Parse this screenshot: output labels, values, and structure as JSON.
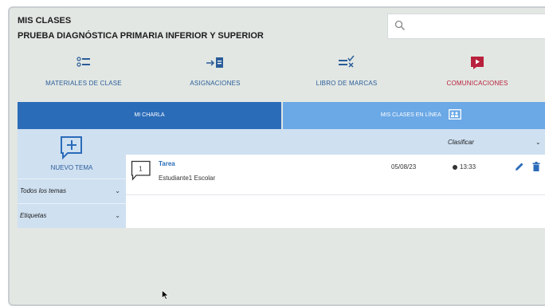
{
  "header": {
    "title": "MIS CLASES",
    "subtitle": "PRUEBA DIAGNÓSTICA PRIMARIA INFERIOR Y SUPERIOR"
  },
  "search": {
    "placeholder": ""
  },
  "nav": [
    {
      "label": "MATERIALES DE CLASE",
      "icon": "list-materials-icon",
      "color": "#2b5d99"
    },
    {
      "label": "ASIGNACIONES",
      "icon": "assignment-arrow-icon",
      "color": "#2b5d99"
    },
    {
      "label": "LIBRO DE MARCAS",
      "icon": "gradebook-check-icon",
      "color": "#2b5d99"
    },
    {
      "label": "COMUNICACIONES",
      "icon": "play-message-icon",
      "color": "#b8213c"
    }
  ],
  "tabs": [
    {
      "label": "MI CHARLA",
      "active": true
    },
    {
      "label": "MIS CLASES EN LÍNEA",
      "active": false
    }
  ],
  "sidebar": {
    "new_topic": "NUEVO TEMA",
    "filters": [
      {
        "label": "Todos los temas"
      },
      {
        "label": "Etiquetas"
      }
    ]
  },
  "sort": {
    "label": "Clasificar"
  },
  "posts": [
    {
      "count": "1",
      "title": "Tarea",
      "author": "Estudiante1 Escolar",
      "date": "05/08/23",
      "time": "13:33"
    }
  ],
  "colors": {
    "primary": "#2b6cb9",
    "tab_inactive": "#6aa8e6",
    "accent_red": "#b8213c",
    "panel": "#cfe0f1",
    "background": "#e2e7e3"
  }
}
